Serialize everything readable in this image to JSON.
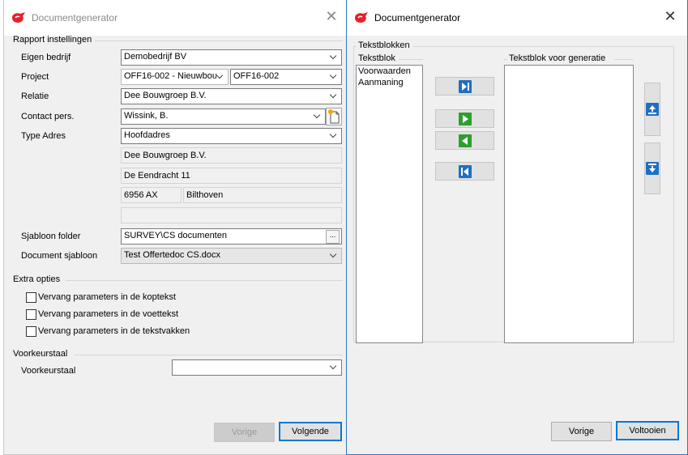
{
  "win1": {
    "title": "Documentgenerator",
    "close_glyph": "✕",
    "section_report": "Rapport instellingen",
    "labels": {
      "company": "Eigen bedrijf",
      "project": "Project",
      "relation": "Relatie",
      "contact": "Contact pers.",
      "address_type": "Type Adres",
      "template_folder": "Sjabloon folder",
      "doc_template": "Document sjabloon"
    },
    "values": {
      "company": "Demobedrijf BV",
      "project_name": "OFF16-002 - Nieuwbou",
      "project_code": "OFF16-002",
      "relation": "Dee Bouwgroep B.V.",
      "contact": "Wissink, B.",
      "address_type": "Hoofdadres",
      "addr_line1": "Dee Bouwgroep B.V.",
      "addr_line2": "De Eendracht 11",
      "postcode": "6956 AX",
      "city": "Bilthoven",
      "addr_line4": "",
      "template_folder": "SURVEY\\CS documenten",
      "doc_template": "Test Offertedoc CS.docx"
    },
    "browse_label": "...",
    "section_extra": "Extra opties",
    "options": [
      {
        "label": "Vervang parameters in de koptekst",
        "checked": false
      },
      {
        "label": "Vervang parameters in de voettekst",
        "checked": false
      },
      {
        "label": "Vervang parameters in de tekstvakken",
        "checked": false
      }
    ],
    "section_language": "Voorkeurstaal",
    "language_label": "Voorkeurstaal",
    "language_value": "",
    "btn_prev": "Vorige",
    "btn_next": "Volgende"
  },
  "win2": {
    "title": "Documentgenerator",
    "close_glyph": "✕",
    "section_blocks": "Tekstblokken",
    "available_header": "Tekstblok",
    "available_items": [
      "Voorwaarden",
      "Aanmaning"
    ],
    "selected_header": "Tekstblok voor generatie",
    "selected_items": [],
    "btn_prev": "Vorige",
    "btn_finish": "Voltooien"
  },
  "colors": {
    "logo_red": "#e8202a",
    "accent_blue": "#0078d7",
    "icon_blue": "#1f6fc0",
    "icon_green": "#2e9e2e"
  }
}
